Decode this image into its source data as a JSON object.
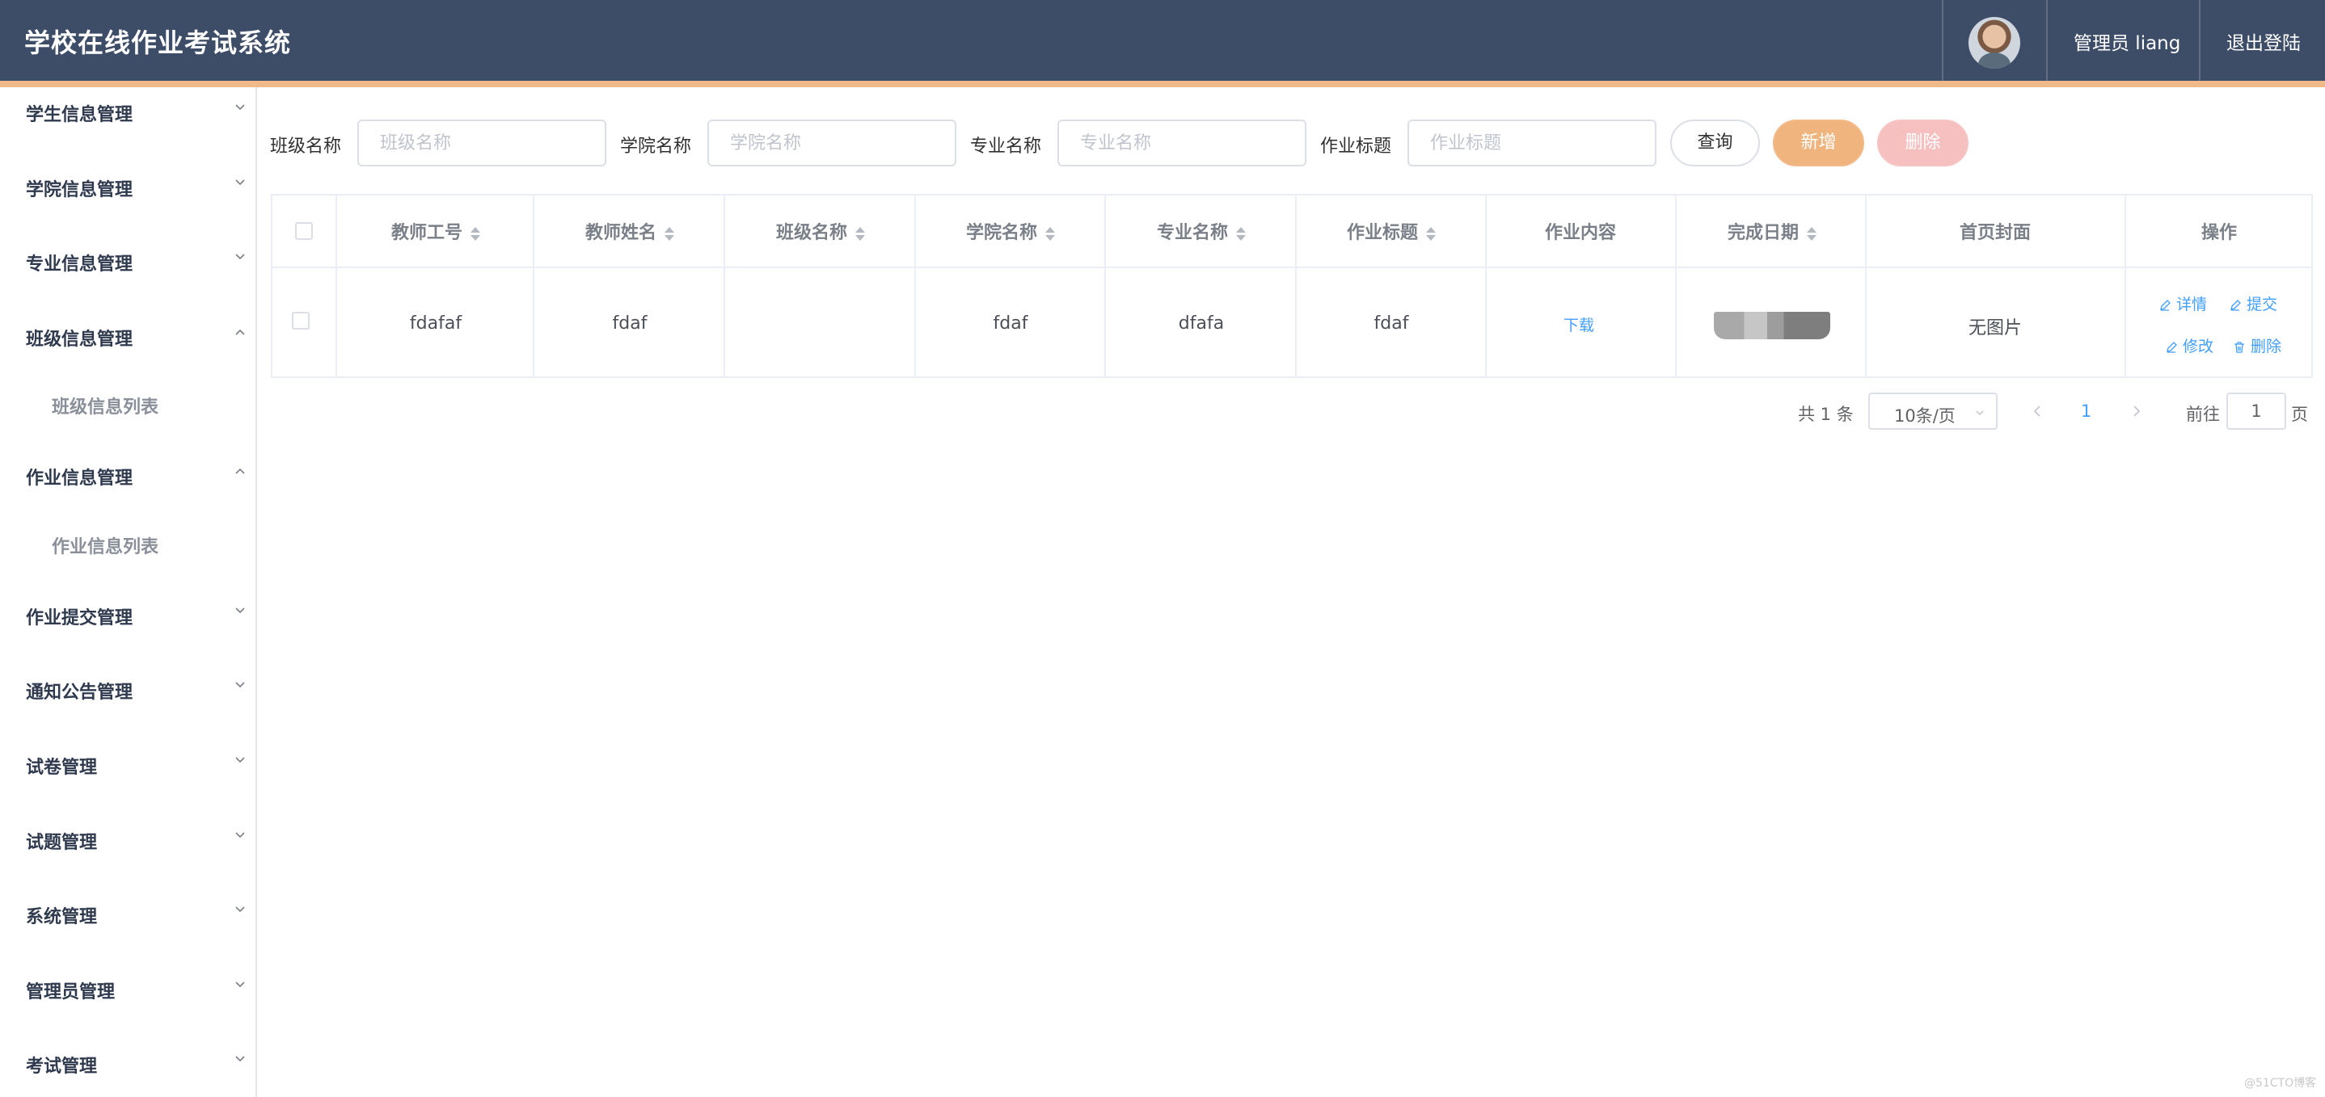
{
  "header": {
    "title": "学校在线作业考试系统",
    "user_label": "管理员 liang",
    "logout_label": "退出登陆"
  },
  "sidebar": {
    "items": [
      {
        "label": "学生信息管理",
        "expanded": false
      },
      {
        "label": "学院信息管理",
        "expanded": false
      },
      {
        "label": "专业信息管理",
        "expanded": false
      },
      {
        "label": "班级信息管理",
        "expanded": true,
        "sub": "班级信息列表"
      },
      {
        "label": "作业信息管理",
        "expanded": true,
        "sub": "作业信息列表"
      },
      {
        "label": "作业提交管理",
        "expanded": false
      },
      {
        "label": "通知公告管理",
        "expanded": false
      },
      {
        "label": "试卷管理",
        "expanded": false
      },
      {
        "label": "试题管理",
        "expanded": false
      },
      {
        "label": "系统管理",
        "expanded": false
      },
      {
        "label": "管理员管理",
        "expanded": false
      },
      {
        "label": "考试管理",
        "expanded": false
      }
    ]
  },
  "search": {
    "class_label": "班级名称",
    "class_placeholder": "班级名称",
    "class_value": "",
    "college_label": "学院名称",
    "college_placeholder": "学院名称",
    "college_value": "",
    "major_label": "专业名称",
    "major_placeholder": "专业名称",
    "major_value": "",
    "title_label": "作业标题",
    "title_placeholder": "作业标题",
    "title_value": "",
    "query_label": "查询",
    "add_label": "新增",
    "delete_label": "删除"
  },
  "table": {
    "headers": [
      "教师工号",
      "教师姓名",
      "班级名称",
      "学院名称",
      "专业名称",
      "作业标题",
      "作业内容",
      "完成日期",
      "首页封面",
      "操作"
    ],
    "rows": [
      {
        "teacher_id": "fdafaf",
        "teacher_name": "fdaf",
        "class_name": "",
        "college_name": "fdaf",
        "major_name": "dfafa",
        "title": "fdaf",
        "content_link": "下载",
        "cover": "无图片",
        "actions": [
          "详情",
          "提交",
          "修改",
          "删除"
        ]
      }
    ]
  },
  "pagination": {
    "total": "共 1 条",
    "page_size": "10条/页",
    "current_page": "1",
    "goto_label": "前往",
    "goto_value": "1",
    "page_suffix": "页"
  },
  "watermark": "@51CTO博客",
  "colors": {
    "header_bg": "#3d4d68",
    "accent_bar": "#f0b98a",
    "add_button": "#f0b57f",
    "delete_button": "#f6c0c0",
    "link": "#409eff"
  }
}
